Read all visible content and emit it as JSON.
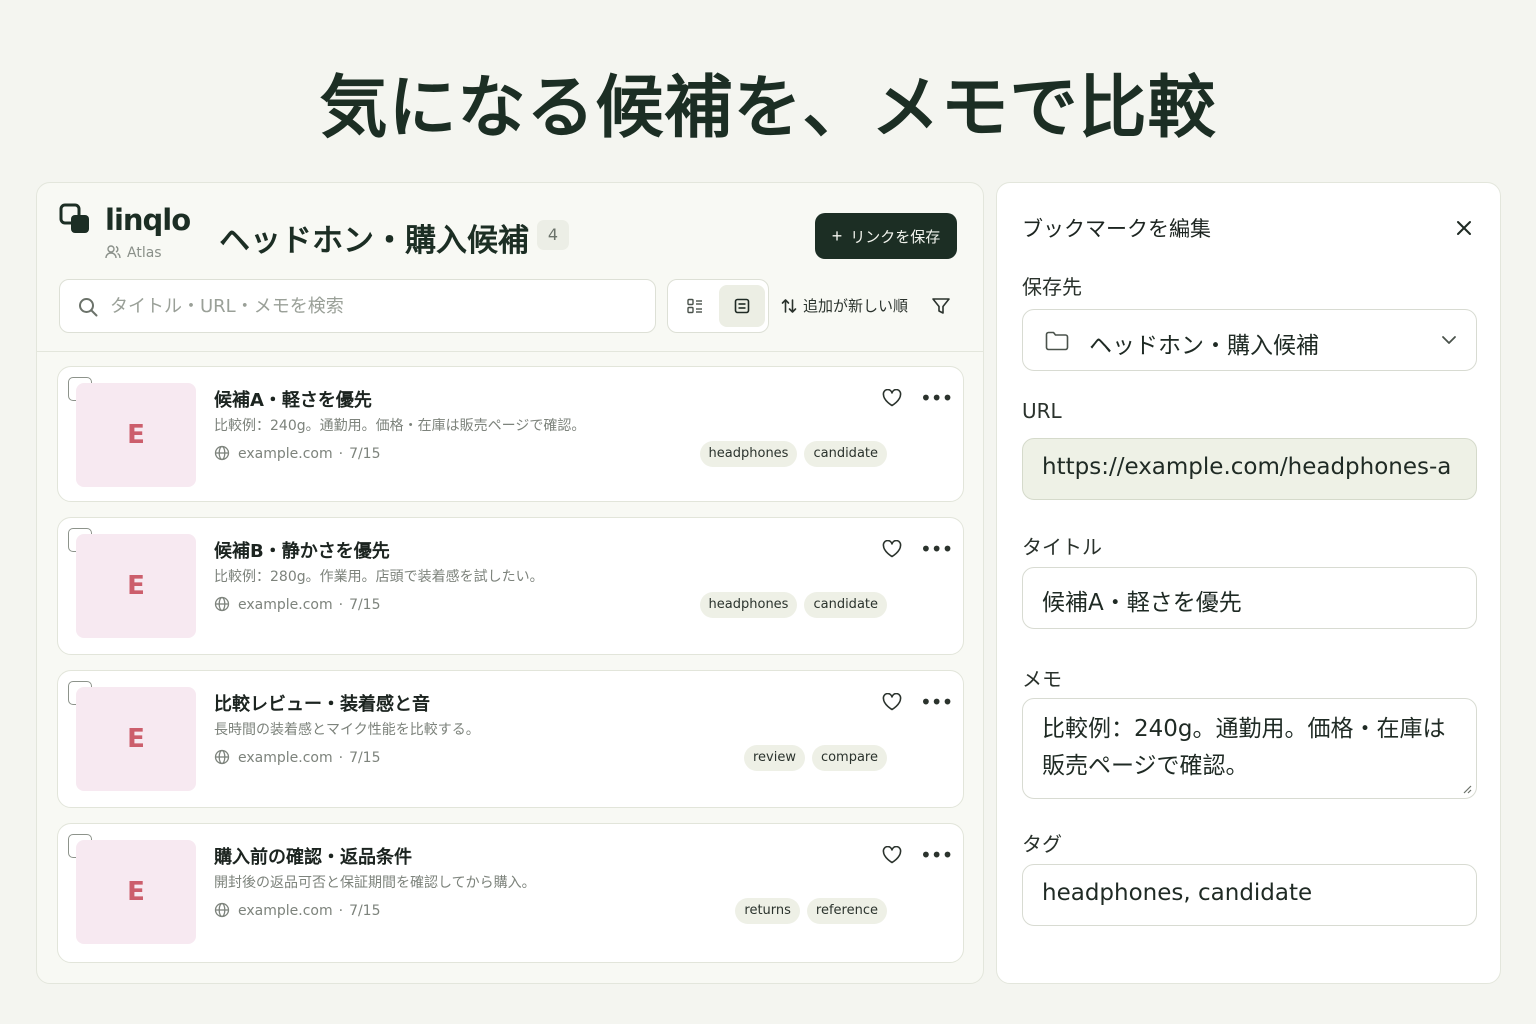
{
  "hero": {
    "title": "気になる候補を、メモで比較"
  },
  "app": {
    "name": "linqlo",
    "workspace": "Atlas"
  },
  "collection": {
    "title": "ヘッドホン・購入候補",
    "count": "4"
  },
  "toolbar": {
    "save_label": "リンクを保存",
    "sort_label": "追加が新しい順"
  },
  "search": {
    "placeholder": "タイトル・URL・メモを検索"
  },
  "bookmarks": [
    {
      "thumb": "E",
      "title": "候補A・軽さを優先",
      "desc": "比較例：240g。通勤用。価格・在庫は販売ページで確認。",
      "domain": "example.com",
      "date": "7/15",
      "tags": [
        "headphones",
        "candidate"
      ]
    },
    {
      "thumb": "E",
      "title": "候補B・静かさを優先",
      "desc": "比較例：280g。作業用。店頭で装着感を試したい。",
      "domain": "example.com",
      "date": "7/15",
      "tags": [
        "headphones",
        "candidate"
      ]
    },
    {
      "thumb": "E",
      "title": "比較レビュー・装着感と音",
      "desc": "長時間の装着感とマイク性能を比較する。",
      "domain": "example.com",
      "date": "7/15",
      "tags": [
        "review",
        "compare"
      ]
    },
    {
      "thumb": "E",
      "title": "購入前の確認・返品条件",
      "desc": "開封後の返品可否と保証期間を確認してから購入。",
      "domain": "example.com",
      "date": "7/15",
      "tags": [
        "returns",
        "reference"
      ]
    }
  ],
  "editor": {
    "title": "ブックマークを編集",
    "dest_label": "保存先",
    "dest_value": "ヘッドホン・購入候補",
    "url_label": "URL",
    "url_value": "https://example.com/headphones-a",
    "title_label": "タイトル",
    "title_value": "候補A・軽さを優先",
    "memo_label": "メモ",
    "memo_value": "比較例：240g。通勤用。価格・在庫は販売ページで確認。",
    "tags_label": "タグ",
    "tags_value": "headphones, candidate"
  },
  "colors": {
    "brand": "#1c2e24",
    "thumb_bg": "#f7e9f1",
    "thumb_text": "#cc5e6c",
    "tag_bg": "#eef0e6"
  }
}
